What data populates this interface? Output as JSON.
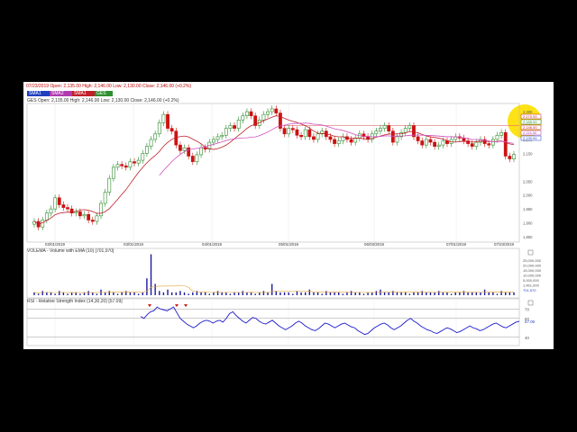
{
  "chart": {
    "ticker_header": "07/23/2019 Open: 2,135.00 High: 2,146.00 Low: 2,130.00 Close: 2,146.00 (+0.2%)",
    "legend": [
      {
        "label": "SMA1",
        "color": "#1f3fbf"
      },
      {
        "label": "SMA2",
        "color": "#b03ab0"
      },
      {
        "label": "SMA1",
        "color": "#c0202a"
      },
      {
        "label": "GES",
        "color": "#2f8f2f"
      }
    ],
    "price_header": "GES Open: 2,135.00 High: 2,146.00 Low: 2,130.00 Close: 2,146.00 (+0.2%)",
    "volume_label": "VOLEMA - Volume with EMA (10) [701,970]",
    "rsi_label": "RSI - Relative Strength Index (14,30,20) [57.09]",
    "date_labels": [
      "03/01/2019",
      "03/01/2019",
      "04/01/2019",
      "05/01/2019",
      "06/03/2019",
      "07/01/2019",
      "07/23/2019"
    ],
    "price_axis": [
      "2,300",
      "2,250",
      "2,200",
      "2,150",
      "2,050",
      "2,000",
      "1,950",
      "1,900",
      "1,850"
    ],
    "price_markers": [
      "2,170.00",
      "2,185.00",
      "2,146.00",
      "2,115.00",
      "2,130.00"
    ],
    "volume_axis": [
      "25,000,000",
      "20,000,000",
      "15,000,000",
      "10,000,000",
      "5,000,000",
      "1,461,000",
      "701,970"
    ],
    "rsi_axis": [
      "70",
      "60",
      "57.09",
      "40"
    ],
    "colors": {
      "up": "#2e8b2e",
      "down": "#cc1111",
      "sma_red": "#c0202a",
      "sma_pink": "#d050c0",
      "volume": "#1a1aa0",
      "rsi": "#1a1acc",
      "highlight": "#ffe000"
    }
  },
  "chart_data": {
    "type": "candlestick",
    "title": "GES",
    "ohlc_close": [
      1905,
      1885,
      1910,
      1935,
      1950,
      1990,
      1965,
      1955,
      1950,
      1935,
      1940,
      1925,
      1930,
      1910,
      1905,
      1925,
      1970,
      2010,
      2060,
      2100,
      2110,
      2105,
      2100,
      2120,
      2115,
      2125,
      2150,
      2175,
      2200,
      2220,
      2260,
      2290,
      2240,
      2230,
      2180,
      2160,
      2170,
      2140,
      2120,
      2145,
      2170,
      2165,
      2190,
      2200,
      2210,
      2215,
      2240,
      2250,
      2240,
      2270,
      2285,
      2300,
      2285,
      2250,
      2270,
      2290,
      2300,
      2310,
      2295,
      2240,
      2220,
      2240,
      2235,
      2215,
      2210,
      2235,
      2210,
      2200,
      2220,
      2230,
      2210,
      2200,
      2185,
      2195,
      2210,
      2200,
      2190,
      2205,
      2220,
      2210,
      2200,
      2220,
      2230,
      2240,
      2250,
      2230,
      2190,
      2210,
      2225,
      2240,
      2250,
      2210,
      2195,
      2180,
      2200,
      2190,
      2175,
      2180,
      2195,
      2185,
      2200,
      2210,
      2205,
      2195,
      2185,
      2175,
      2190,
      2200,
      2185,
      2180,
      2200,
      2215,
      2225,
      2140,
      2130,
      2146
    ],
    "volume_millions": [
      2,
      1,
      3,
      2,
      2,
      1,
      3,
      2,
      1,
      2,
      2,
      1,
      2,
      3,
      2,
      1,
      4,
      2,
      3,
      2,
      1,
      2,
      3,
      2,
      2,
      1,
      2,
      12,
      29,
      8,
      3,
      2,
      4,
      2,
      2,
      3,
      2,
      1,
      2,
      3,
      2,
      2,
      1,
      2,
      3,
      2,
      2,
      1,
      2,
      2,
      3,
      2,
      2,
      1,
      2,
      3,
      2,
      8,
      3,
      2,
      2,
      2,
      1,
      3,
      2,
      2,
      4,
      2,
      2,
      1,
      3,
      2,
      2,
      2,
      1,
      2,
      3,
      2,
      2,
      1,
      2,
      2,
      3,
      4,
      2,
      2,
      3,
      2,
      2,
      2,
      1,
      2,
      2,
      3,
      2,
      2,
      2,
      3,
      2,
      2,
      1,
      2,
      2,
      3,
      2,
      2,
      2,
      2,
      4,
      2,
      2,
      1,
      3,
      2,
      2,
      2
    ],
    "rsi": [
      62,
      60,
      64,
      67,
      68,
      72,
      70,
      69,
      68,
      70,
      72,
      66,
      60,
      57,
      54,
      52,
      50,
      52,
      55,
      57,
      58,
      57,
      55,
      57,
      58,
      56,
      60,
      65,
      67,
      63,
      60,
      57,
      55,
      58,
      61,
      60,
      57,
      55,
      54,
      56,
      58,
      55,
      52,
      50,
      48,
      50,
      52,
      55,
      57,
      55,
      52,
      50,
      48,
      47,
      49,
      52,
      55,
      54,
      52,
      50,
      52,
      54,
      55,
      53,
      51,
      50,
      47,
      45,
      43,
      44,
      47,
      50,
      52,
      54,
      55,
      53,
      50,
      48,
      50,
      52,
      55,
      58,
      60,
      57,
      55,
      52,
      50,
      48,
      47,
      45,
      44,
      46,
      48,
      50,
      49,
      47,
      45,
      46,
      48,
      50,
      52,
      50,
      49,
      47,
      48,
      50,
      52,
      54,
      55,
      53,
      51,
      50,
      52,
      54,
      56,
      57
    ]
  }
}
